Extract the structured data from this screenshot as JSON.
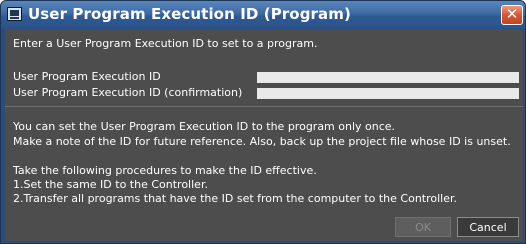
{
  "window": {
    "title": "User Program Execution ID (Program)",
    "close_glyph": "✕"
  },
  "form": {
    "intro": "Enter a User Program Execution ID to set to a program.",
    "fields": [
      {
        "label": "User Program Execution ID",
        "value": ""
      },
      {
        "label": "User Program Execution ID (confirmation)",
        "value": ""
      }
    ]
  },
  "notes": {
    "line1": "You can set the User Program Execution ID to the program only once.",
    "line2": "Make a note of the ID for future reference. Also, back up the project file whose ID is unset.",
    "line3": "Take the following procedures to make the ID effective.",
    "line4": "1.Set the same ID to the Controller.",
    "line5": "2.Transfer all programs that have the ID set from the computer to the Controller."
  },
  "buttons": {
    "ok_label": "OK",
    "cancel_label": "Cancel"
  },
  "colors": {
    "titlebar": "#3e6aa3",
    "body": "#4d4d4d",
    "close": "#d65533"
  },
  "icons": {
    "app": "computer-monitor-icon",
    "close": "close-icon"
  }
}
